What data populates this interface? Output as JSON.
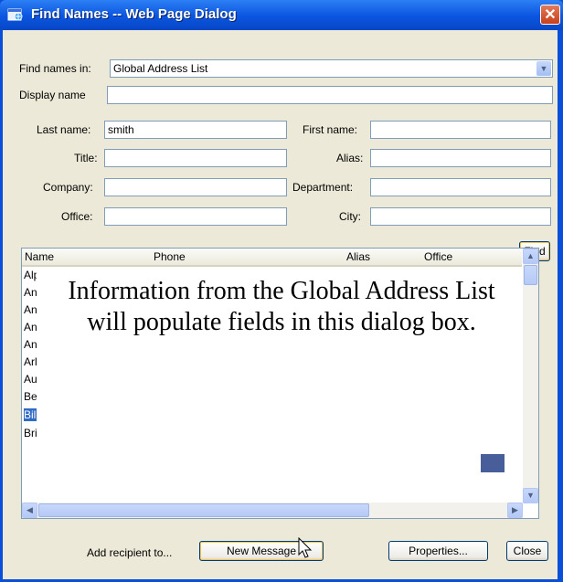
{
  "window": {
    "title": "Find Names -- Web Page Dialog",
    "close_glyph": "✕"
  },
  "form": {
    "find_in_label": "Find names in:",
    "find_in_value": "Global Address List",
    "display_name_label": "Display name",
    "last_name_label": "Last name:",
    "last_name_value": "smith",
    "first_name_label": "First name:",
    "title_label": "Title:",
    "alias_label": "Alias:",
    "company_label": "Company:",
    "department_label": "Department:",
    "office_label": "Office:",
    "city_label": "City:",
    "find_button": "Find"
  },
  "results": {
    "columns": [
      "Name",
      "Phone",
      "Alias",
      "Office"
    ],
    "rows": [
      "Alpl",
      "Anc",
      "Ane",
      "Ang",
      "Anr",
      "Arle",
      "Aur",
      "Bet",
      "Billy",
      "Brit"
    ],
    "selected_index": 8
  },
  "overlay_text": "Information from the Global Address List will populate fields in this dialog box.",
  "footer": {
    "add_recipient_label": "Add recipient to...",
    "new_message_button": "New Message",
    "properties_button": "Properties...",
    "close_button": "Close"
  }
}
